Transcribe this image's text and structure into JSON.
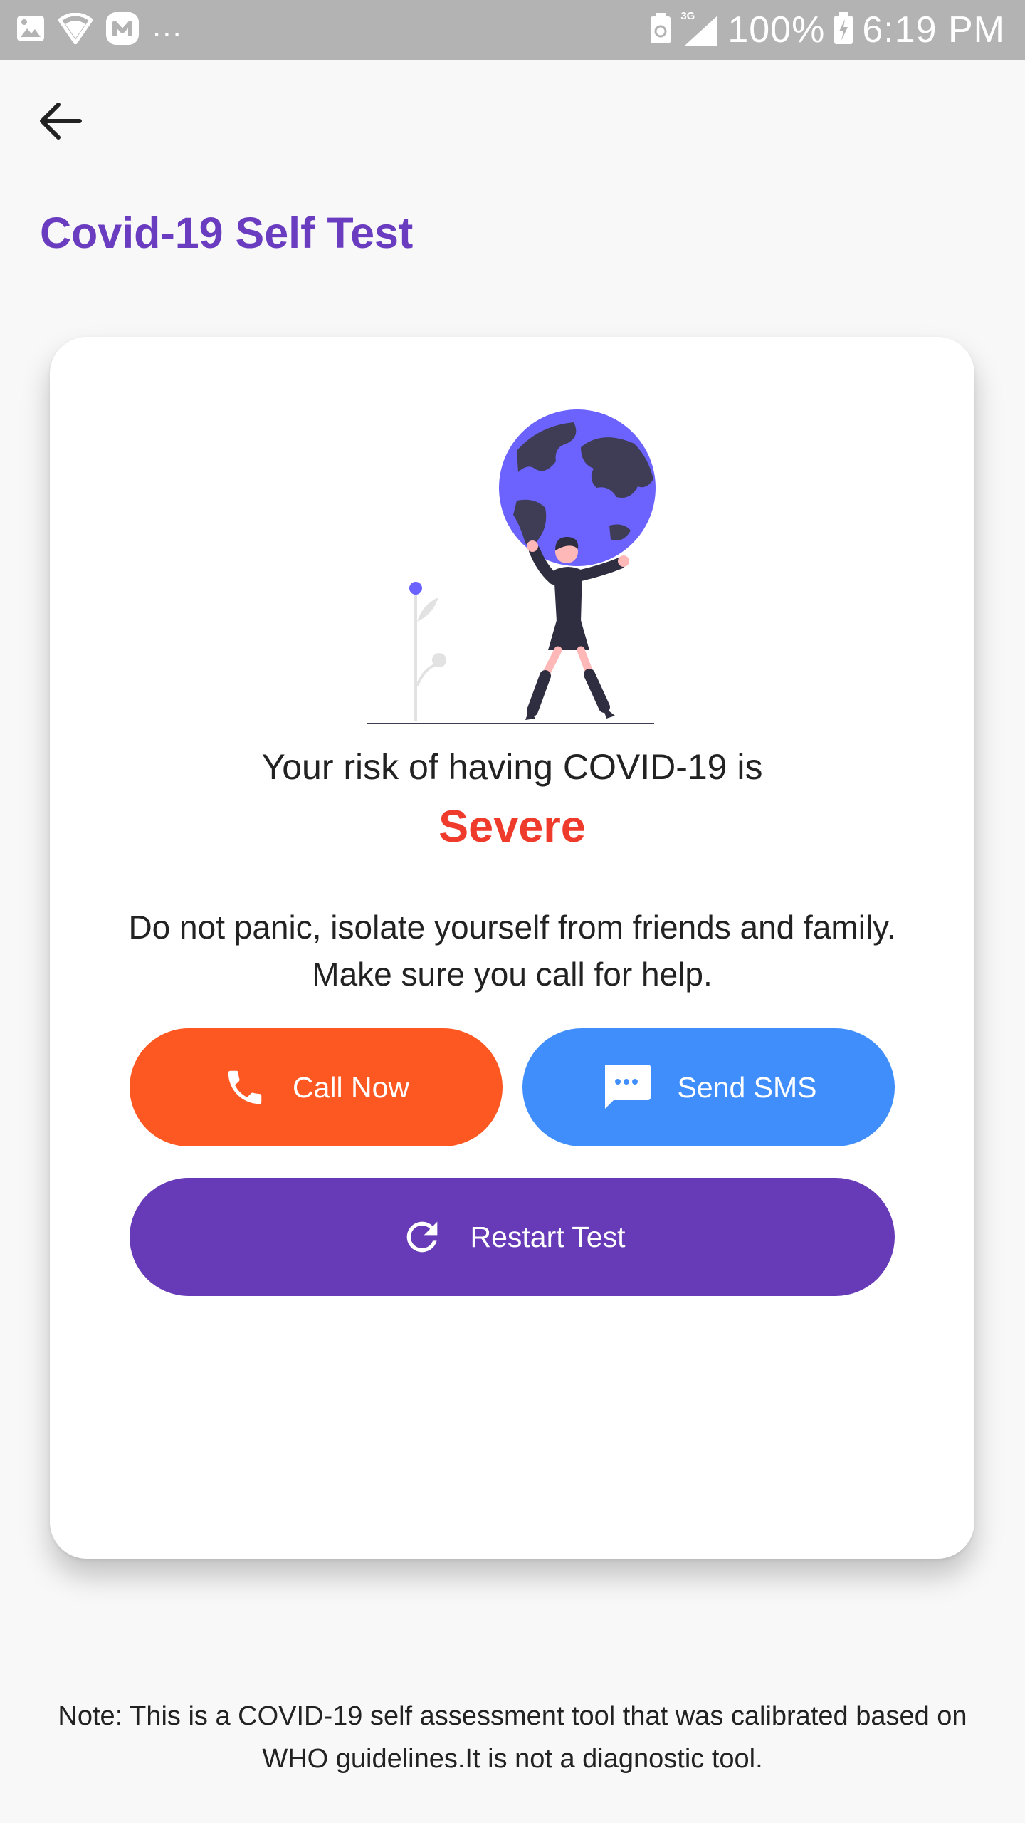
{
  "status_bar": {
    "battery": "100%",
    "time": "6:19 PM",
    "network_label": "3G",
    "left_icons": [
      "image-icon",
      "wifi-icon",
      "app-icon"
    ],
    "ellipsis": "..."
  },
  "header": {
    "title": "Covid-19 Self Test"
  },
  "result": {
    "risk_text": "Your risk of having COVID-19 is",
    "risk_level": "Severe",
    "advice": "Do not panic, isolate yourself from friends and family. Make sure you call for help."
  },
  "actions": {
    "call_label": "Call Now",
    "sms_label": "Send SMS",
    "restart_label": "Restart Test"
  },
  "footer": {
    "note": "Note: This is a COVID-19 self assessment tool that was calibrated based on WHO guidelines.It is not a diagnostic tool."
  },
  "colors": {
    "title": "#6a3cc0",
    "risk_severe": "#ef3b2c",
    "call_button": "#fd5722",
    "sms_button": "#3f8efc",
    "restart_button": "#673ab7",
    "status_bar": "#b3b3b3"
  }
}
